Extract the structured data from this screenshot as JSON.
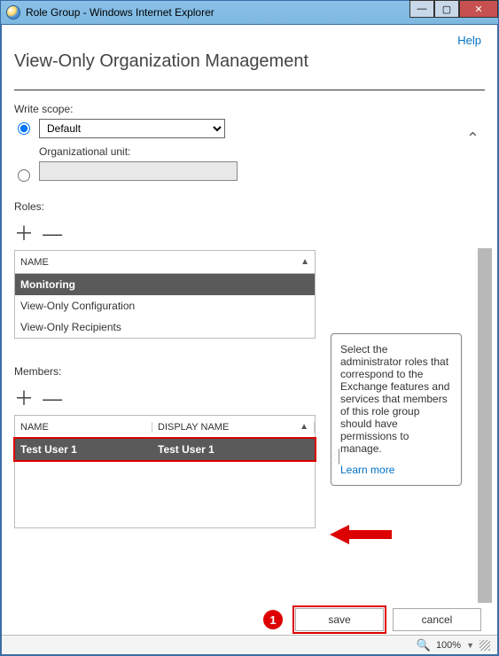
{
  "window": {
    "title": "Role Group - Windows Internet Explorer"
  },
  "header": {
    "help": "Help",
    "page_title": "View-Only Organization Management"
  },
  "scope": {
    "label": "Write scope:",
    "default_option": "Default",
    "ou_label": "Organizational unit:",
    "ou_value": ""
  },
  "roles": {
    "label": "Roles:",
    "col_name": "NAME",
    "items": [
      {
        "name": "Monitoring",
        "selected": true
      },
      {
        "name": "View-Only Configuration",
        "selected": false
      },
      {
        "name": "View-Only Recipients",
        "selected": false
      }
    ]
  },
  "members": {
    "label": "Members:",
    "col_name": "NAME",
    "col_display": "DISPLAY NAME",
    "items": [
      {
        "name": "Test User 1",
        "display": "Test User 1",
        "selected": true
      }
    ]
  },
  "tooltip": {
    "text": "Select the administrator roles that correspond to the Exchange features and services that members of this role group should have permissions to manage.",
    "link": "Learn more"
  },
  "footer": {
    "save": "save",
    "cancel": "cancel",
    "callout": "1"
  },
  "status": {
    "zoom": "100%"
  }
}
